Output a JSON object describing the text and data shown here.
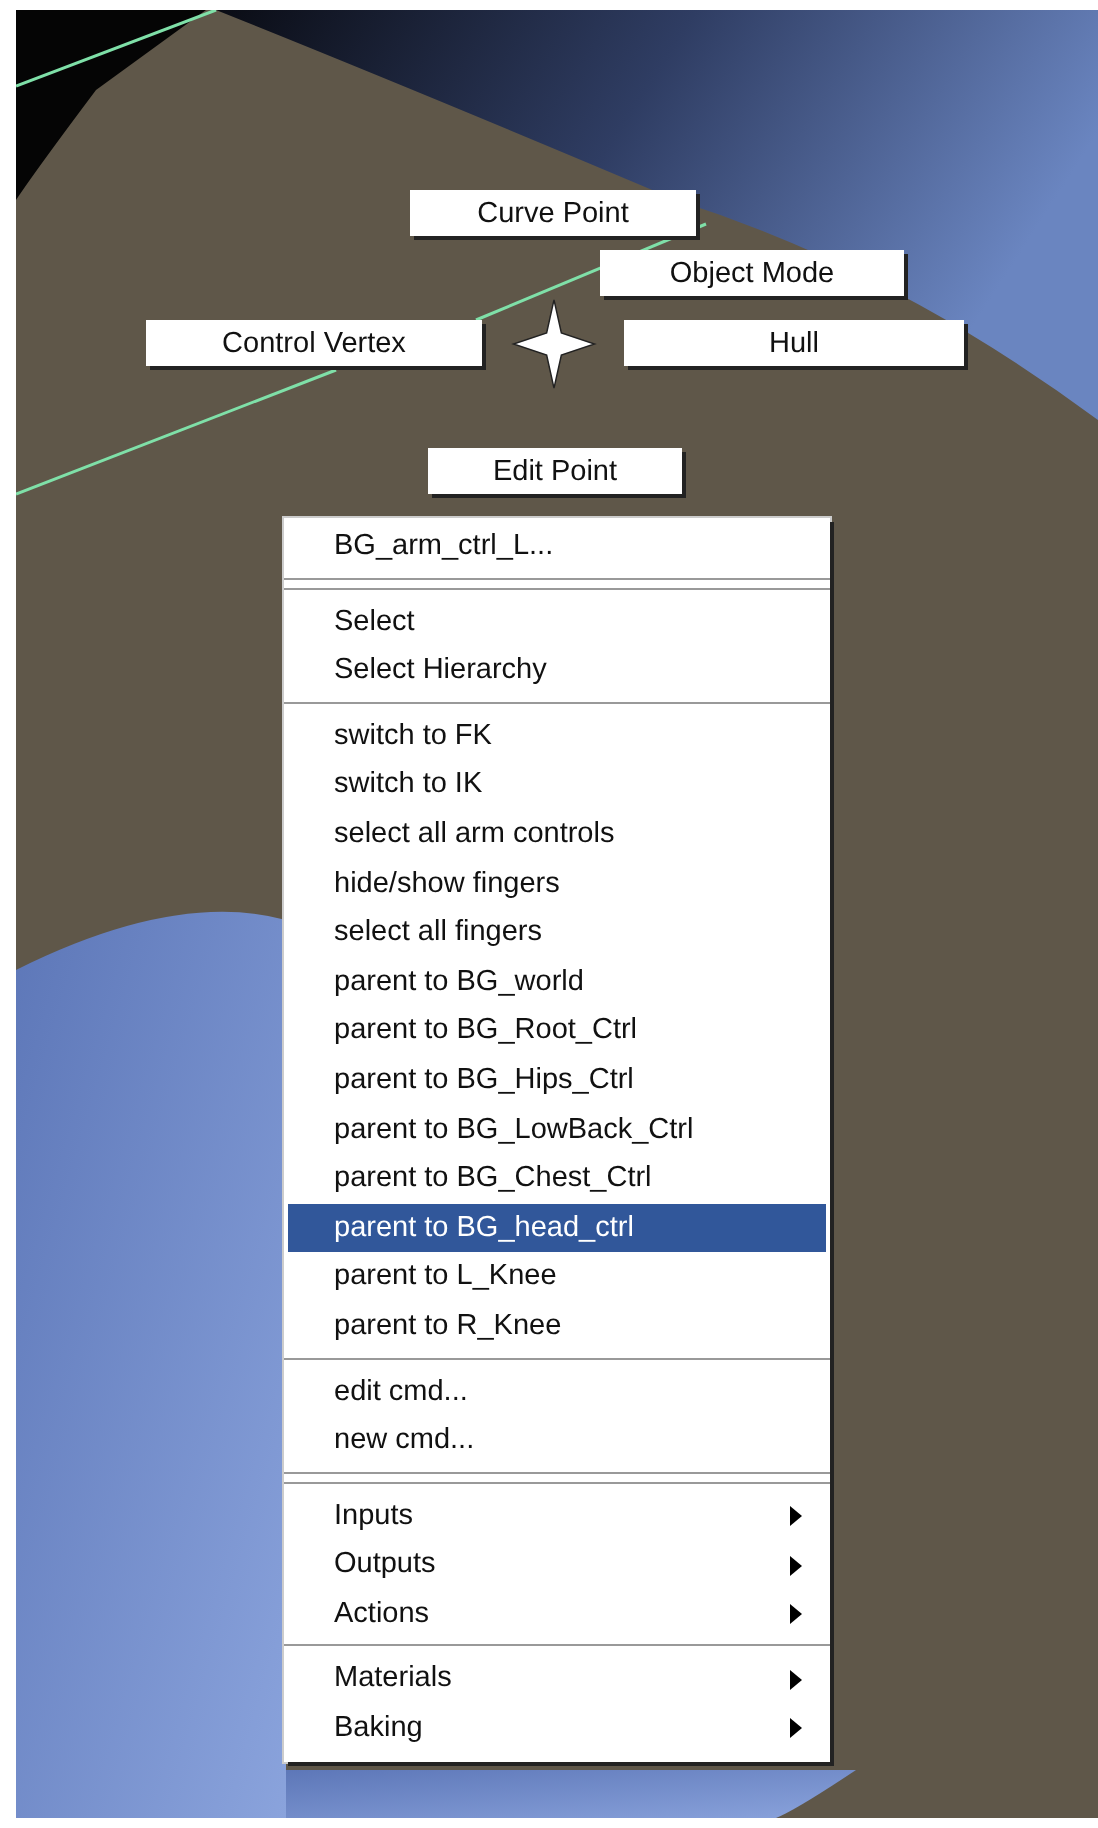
{
  "marking_menu": {
    "items": [
      {
        "label": "Curve Point"
      },
      {
        "label": "Object Mode"
      },
      {
        "label": "Control Vertex"
      },
      {
        "label": "Hull"
      },
      {
        "label": "Edit Point"
      }
    ]
  },
  "popup_menu": {
    "title": "BG_arm_ctrl_L...",
    "groups": [
      {
        "double_rule": true,
        "items": [
          {
            "label": "Select",
            "selected": false,
            "submenu": false
          },
          {
            "label": "Select Hierarchy",
            "selected": false,
            "submenu": false
          }
        ]
      },
      {
        "double_rule": false,
        "items": [
          {
            "label": "switch to FK",
            "selected": false,
            "submenu": false
          },
          {
            "label": "switch to IK",
            "selected": false,
            "submenu": false
          },
          {
            "label": "select all arm controls",
            "selected": false,
            "submenu": false
          },
          {
            "label": "hide/show fingers",
            "selected": false,
            "submenu": false
          },
          {
            "label": "select all fingers",
            "selected": false,
            "submenu": false
          },
          {
            "label": "parent to BG_world",
            "selected": false,
            "submenu": false
          },
          {
            "label": "parent to BG_Root_Ctrl",
            "selected": false,
            "submenu": false
          },
          {
            "label": "parent to BG_Hips_Ctrl",
            "selected": false,
            "submenu": false
          },
          {
            "label": "parent to BG_LowBack_Ctrl",
            "selected": false,
            "submenu": false
          },
          {
            "label": "parent to BG_Chest_Ctrl",
            "selected": false,
            "submenu": false
          },
          {
            "label": "parent to BG_head_ctrl",
            "selected": true,
            "submenu": false
          },
          {
            "label": "parent to L_Knee",
            "selected": false,
            "submenu": false
          },
          {
            "label": "parent to R_Knee",
            "selected": false,
            "submenu": false
          }
        ]
      },
      {
        "double_rule": false,
        "items": [
          {
            "label": "edit cmd...",
            "selected": false,
            "submenu": false
          },
          {
            "label": "new cmd...",
            "selected": false,
            "submenu": false
          }
        ]
      },
      {
        "double_rule": true,
        "items": [
          {
            "label": "Inputs",
            "selected": false,
            "submenu": true
          },
          {
            "label": "Outputs",
            "selected": false,
            "submenu": true
          },
          {
            "label": "Actions",
            "selected": false,
            "submenu": true
          }
        ]
      },
      {
        "double_rule": false,
        "items": [
          {
            "label": "Materials",
            "selected": false,
            "submenu": true
          },
          {
            "label": "Baking",
            "selected": false,
            "submenu": true
          }
        ]
      }
    ]
  }
}
